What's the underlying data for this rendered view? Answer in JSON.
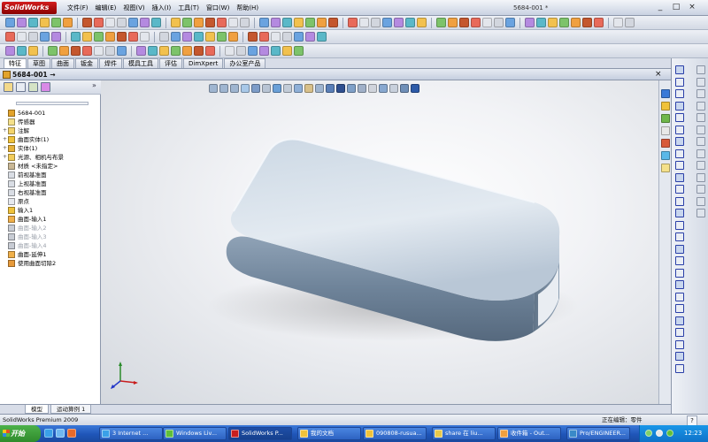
{
  "app": {
    "logo_text": "SolidWorks",
    "document_title": "5684-001 *"
  },
  "menu": [
    "文件(F)",
    "编辑(E)",
    "视图(V)",
    "插入(I)",
    "工具(T)",
    "窗口(W)",
    "帮助(H)"
  ],
  "window_controls": {
    "minimize": "_",
    "restore": "□",
    "close": "×"
  },
  "command_tabs": [
    "特征",
    "草图",
    "曲面",
    "钣金",
    "焊件",
    "模具工具",
    "评估",
    "DimXpert",
    "办公室产品"
  ],
  "document": {
    "tab_title": "5684-001 →",
    "close": "×"
  },
  "feature_manager": {
    "expand_symbol": "»",
    "tree": [
      {
        "label": "5684-001",
        "icon": "part-icon",
        "expand": "",
        "dim": false,
        "color": "#e2a32b"
      },
      {
        "label": "传感器",
        "icon": "sensor-icon",
        "expand": "",
        "dim": false,
        "color": "#f4e08a"
      },
      {
        "label": "注解",
        "icon": "annotation-icon",
        "expand": "+",
        "dim": false,
        "color": "#f3d36a"
      },
      {
        "label": "曲面实体(1)",
        "icon": "surface-body-icon",
        "expand": "+",
        "dim": false,
        "color": "#f0c23a"
      },
      {
        "label": "实体(1)",
        "icon": "solid-body-icon",
        "expand": "+",
        "dim": false,
        "color": "#e7b23a"
      },
      {
        "label": "光源、相机与布景",
        "icon": "lights-icon",
        "expand": "+",
        "dim": false,
        "color": "#f2cc5a"
      },
      {
        "label": "材质 <未指定>",
        "icon": "material-icon",
        "expand": "",
        "dim": false,
        "color": "#c9b896"
      },
      {
        "label": "前视基准面",
        "icon": "plane-icon",
        "expand": "",
        "dim": false,
        "color": "#d9dde4"
      },
      {
        "label": "上视基准面",
        "icon": "plane-icon",
        "expand": "",
        "dim": false,
        "color": "#d9dde4"
      },
      {
        "label": "右视基准面",
        "icon": "plane-icon",
        "expand": "",
        "dim": false,
        "color": "#d9dde4"
      },
      {
        "label": "原点",
        "icon": "origin-icon",
        "expand": "",
        "dim": false,
        "color": "#e6e9ee"
      },
      {
        "label": "输入1",
        "icon": "import-icon",
        "expand": "",
        "dim": false,
        "color": "#f0c23a"
      },
      {
        "label": "曲面-输入1",
        "icon": "surface-import-icon",
        "expand": "",
        "dim": false,
        "color": "#f0b04a"
      },
      {
        "label": "曲面-输入2",
        "icon": "surface-import-icon",
        "expand": "",
        "dim": true,
        "color": "#c8ccd4"
      },
      {
        "label": "曲面-输入3",
        "icon": "surface-import-icon",
        "expand": "",
        "dim": true,
        "color": "#c8ccd4"
      },
      {
        "label": "曲面-输入4",
        "icon": "surface-import-icon",
        "expand": "",
        "dim": true,
        "color": "#c8ccd4"
      },
      {
        "label": "曲面-延伸1",
        "icon": "surface-extend-icon",
        "expand": "",
        "dim": false,
        "color": "#f0b04a"
      },
      {
        "label": "使用曲面切除2",
        "icon": "surface-cut-icon",
        "expand": "",
        "dim": false,
        "color": "#e79a3a"
      }
    ]
  },
  "bottom_tabs": [
    "模型",
    "运动算例 1"
  ],
  "status": {
    "left": "SolidWorks Premium 2009",
    "right": "正在编辑：零件",
    "help": "?"
  },
  "taskbar": {
    "start_label": "开始",
    "items": [
      {
        "label": "3 Internet ...",
        "active": false
      },
      {
        "label": "Windows Liv...",
        "active": false
      },
      {
        "label": "SolidWorks P...",
        "active": true
      },
      {
        "label": "我的文档",
        "active": false
      },
      {
        "label": "090808-rusua...",
        "active": false
      },
      {
        "label": "share 在 liu...",
        "active": false
      },
      {
        "label": "收件箱 - Out...",
        "active": false
      },
      {
        "label": "Pro/ENGINEER...",
        "active": false
      }
    ],
    "clock": "12:23"
  },
  "colors": {
    "model_light": "#d3dde7",
    "model_mid": "#9eb0c2",
    "model_dark": "#5b6f84",
    "accent_red": "#c81e1e"
  }
}
